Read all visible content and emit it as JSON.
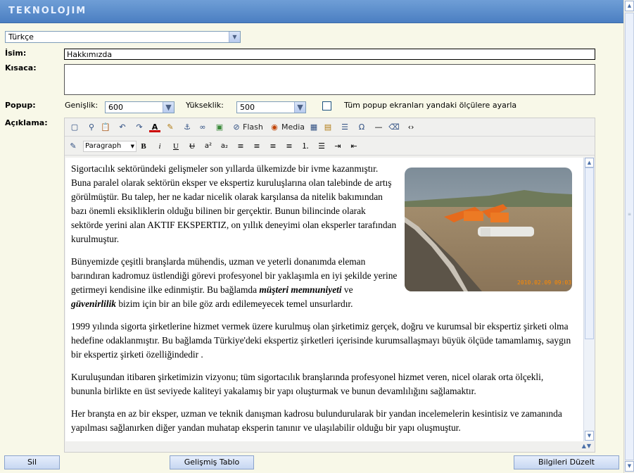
{
  "header": {
    "logo_text": "TEKNOLOJIM"
  },
  "form": {
    "language": {
      "selected": "Türkçe"
    },
    "name": {
      "label": "İsim:",
      "value": "Hakkımızda"
    },
    "short": {
      "label": "Kısaca:",
      "value": ""
    },
    "popup": {
      "label": "Popup:",
      "width_label": "Genişlik:",
      "width_value": "600",
      "height_label": "Yükseklik:",
      "height_value": "500",
      "checkbox_label": "Tüm popup ekranları yandaki ölçülere ayarla"
    },
    "description": {
      "label": "Açıklama:"
    }
  },
  "editor": {
    "toolbar": {
      "flash_label": "Flash",
      "media_label": "Media",
      "format_value": "Paragraph"
    },
    "content": {
      "p1": "Sigortacılık sektöründeki gelişmeler son yıllarda ülkemizde bir ivme kazanmıştır. Buna paralel olarak sektörün eksper ve ekspertiz kuruluşlarına olan talebinde de artış görülmüştür. Bu talep, her ne kadar nicelik olarak karşılansa da nitelik bakımından bazı önemli eksikliklerin olduğu bilinen bir gerçektir. Bunun bilincinde olarak sektörde yerini alan AKTIF EKSPERTIZ, on yıllık deneyimi olan eksperler tarafından kurulmuştur.",
      "p2_a": "Bünyemizde çeşitli branşlarda mühendis, uzman ve yeterli donanımda eleman barındıran kadromuz üstlendiği görevi profesyonel bir yaklaşımla en iyi şekilde yerine getirmeyi kendisine ilke edinmiştir. Bu bağlamda ",
      "p2_b": "müşteri memnuniyeti",
      "p2_c": " ve ",
      "p2_d": "güvenirlilik",
      "p2_e": " bizim için bir an bile göz ardı edilemeyecek temel unsurlardır.",
      "p3": "1999 yılında sigorta şirketlerine hizmet vermek üzere kurulmuş olan şirketimiz gerçek, doğru ve kurumsal bir ekspertiz şirketi olma hedefine odaklanmıştır. Bu bağlamda Türkiye'deki ekspertiz şirketleri içerisinde kurumsallaşmayı büyük ölçüde tamamlamış, saygın bir ekspertiz şirketi özelliğindedir .",
      "p4": "Kuruluşundan itibaren şirketimizin vizyonu; tüm sigortacılık branşlarında profesyonel hizmet veren, nicel olarak orta ölçekli, bununla birlikte en üst seviyede kaliteyi yakalamış bir yapı oluşturmak ve bunun devamlılığını sağlamaktır.",
      "p5": "Her branşta en az bir eksper, uzman ve teknik danışman kadrosu bulundurularak bir yandan incelemelerin kesintisiz ve zamanında yapılması sağlanırken diğer yandan muhatap eksperin tanınır ve ulaşılabilir olduğu bir yapı oluşmuştur.",
      "photo_timestamp": "2010.02.09 09:03"
    }
  },
  "buttons": {
    "delete": "Sil",
    "advanced_table": "Gelişmiş Tablo",
    "update": "Bilgileri Düzelt"
  }
}
